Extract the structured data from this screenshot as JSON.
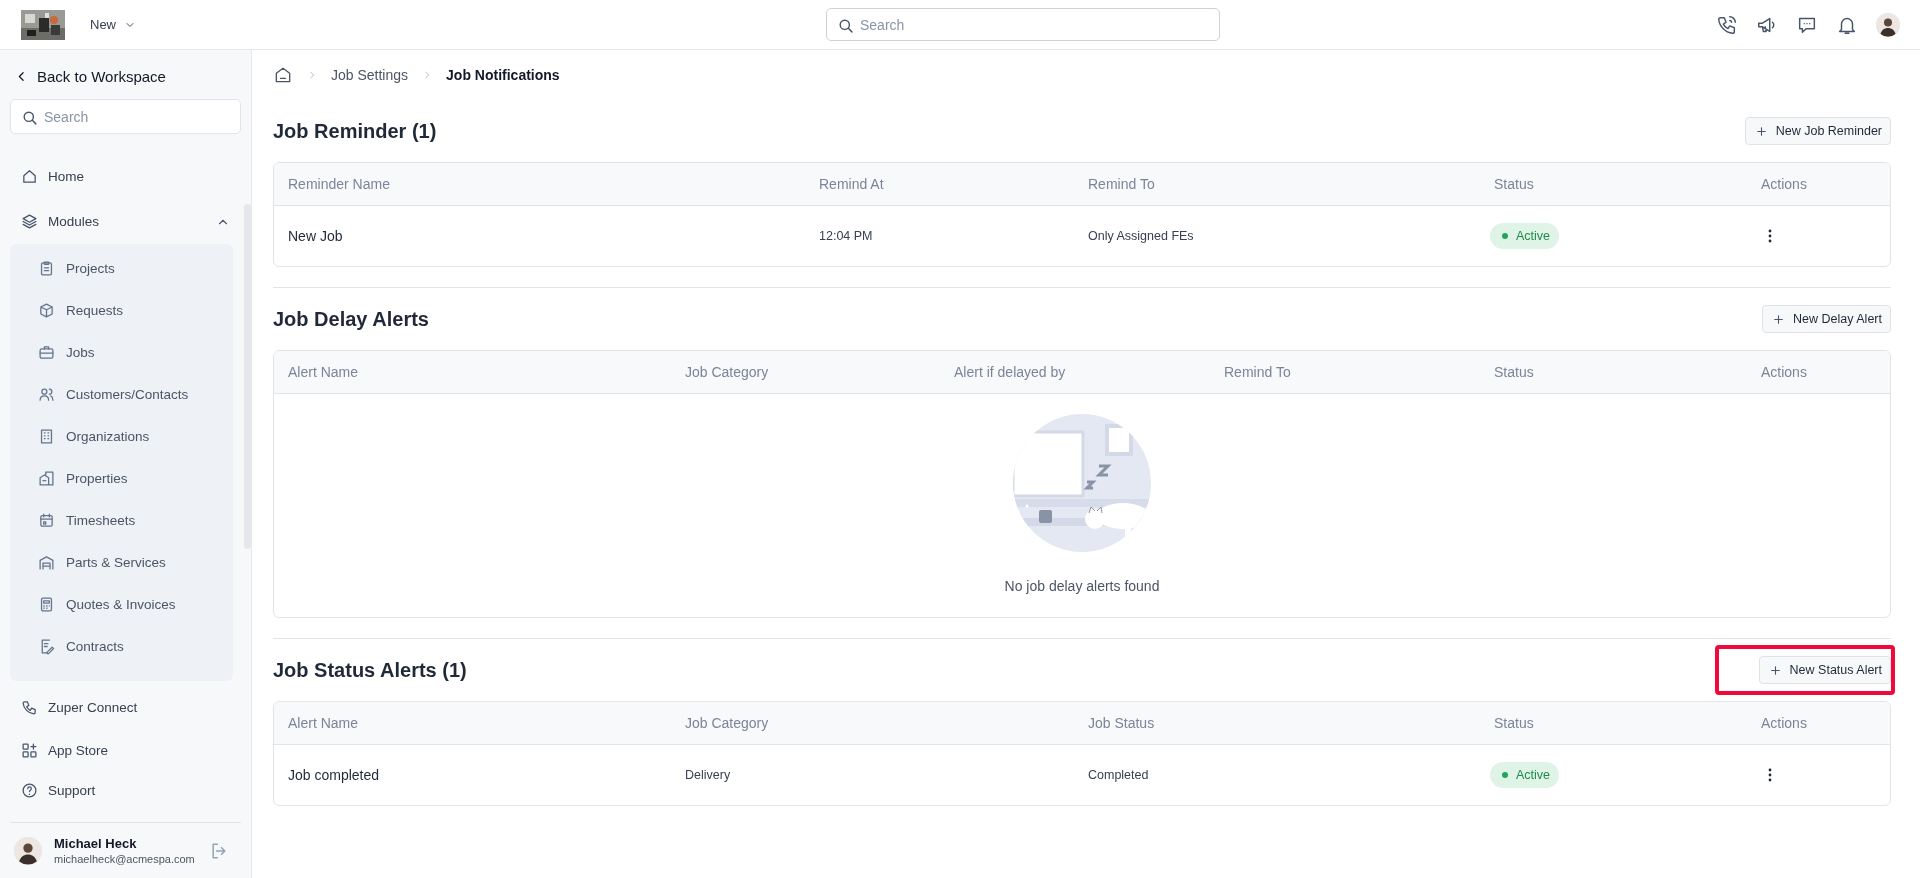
{
  "topbar": {
    "workspace_menu": "New",
    "search": {
      "placeholder": "Search"
    }
  },
  "sidebar": {
    "back_link": "Back to Workspace",
    "search": {
      "placeholder": "Search"
    },
    "items": [
      {
        "label": "Home"
      },
      {
        "label": "Modules",
        "expanded": true,
        "children": [
          {
            "label": "Projects"
          },
          {
            "label": "Requests"
          },
          {
            "label": "Jobs"
          },
          {
            "label": "Customers/Contacts"
          },
          {
            "label": "Organizations"
          },
          {
            "label": "Properties"
          },
          {
            "label": "Timesheets"
          },
          {
            "label": "Parts & Services"
          },
          {
            "label": "Quotes & Invoices"
          },
          {
            "label": "Contracts"
          }
        ]
      },
      {
        "label": "Zuper Connect"
      },
      {
        "label": "App Store"
      },
      {
        "label": "Support"
      }
    ],
    "user": {
      "name": "Michael Heck",
      "email": "michaelheck@acmespa.com"
    }
  },
  "breadcrumb": [
    {
      "label": "Job Settings",
      "current": false
    },
    {
      "label": "Job Notifications",
      "current": true
    }
  ],
  "sections": [
    {
      "title": "Job Reminder (1)",
      "button": {
        "label": "New Job Reminder",
        "highlighted": false
      },
      "table": {
        "columns": [
          "Reminder Name",
          "Remind At",
          "Remind To",
          "Status",
          "Actions"
        ],
        "rows": [
          {
            "cells": [
              "New Job",
              "12:04 PM",
              "Only Assigned FEs"
            ],
            "status": "Active"
          }
        ]
      }
    },
    {
      "title": "Job Delay Alerts",
      "button": {
        "label": "New Delay Alert",
        "highlighted": false
      },
      "table": {
        "columns": [
          "Alert Name",
          "Job Category",
          "Alert if delayed by",
          "Remind To",
          "Status",
          "Actions"
        ],
        "empty_message": "No job delay alerts found"
      }
    },
    {
      "title": "Job Status Alerts (1)",
      "button": {
        "label": "New Status Alert",
        "highlighted": true
      },
      "table": {
        "columns": [
          "Alert Name",
          "Job Category",
          "Job Status",
          "Status",
          "Actions"
        ],
        "rows": [
          {
            "cells": [
              "Job completed",
              "Delivery",
              "Completed"
            ],
            "status": "Active"
          }
        ]
      }
    }
  ]
}
